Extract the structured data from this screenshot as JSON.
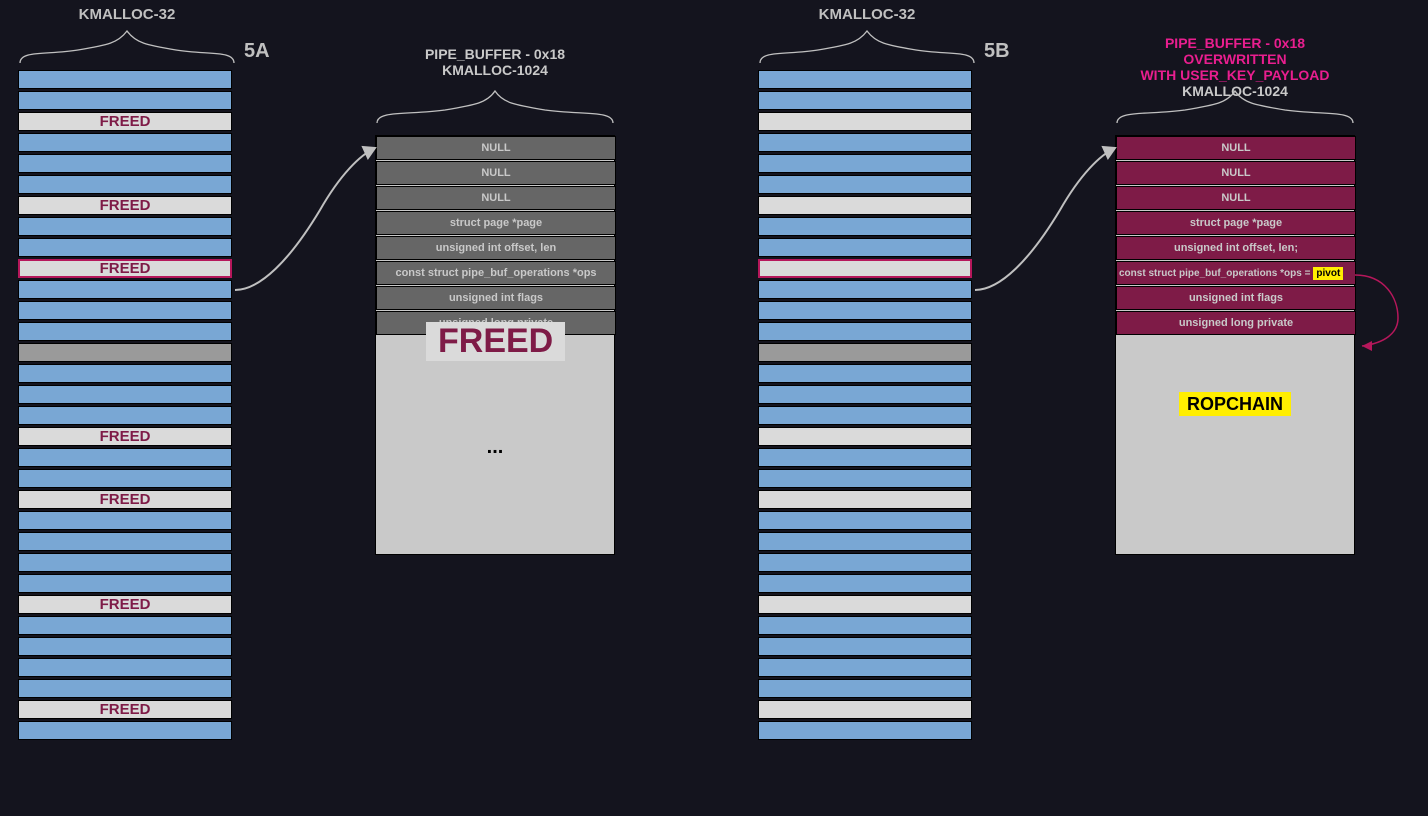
{
  "left_title": "KMALLOC-32",
  "right_title": "KMALLOC-32",
  "step5a": "5A",
  "step5b": "5B",
  "detailA_line1": "PIPE_BUFFER - 0x18",
  "detailA_line2": "KMALLOC-1024",
  "detailB_line1": "PIPE_BUFFER - 0x18 OVERWRITTEN",
  "detailB_line2": "WITH USER_KEY_PAYLOAD",
  "detailB_line3": "KMALLOC-1024",
  "freed_label": "FREED",
  "freed_big": "FREED",
  "ellipsis": "...",
  "ropchain": "ROPCHAIN",
  "pivot": "pivot",
  "rowsA": {
    "r0": "NULL",
    "r1": "NULL",
    "r2": "NULL",
    "r3": "struct page *page",
    "r4": "unsigned int offset, len",
    "r5": "const struct pipe_buf_operations *ops",
    "r6": "unsigned int flags",
    "r7": "unsigned long private"
  },
  "rowsB": {
    "r0": "NULL",
    "r1": "NULL",
    "r2": "NULL",
    "r3": "struct page *page",
    "r4": "unsigned int offset, len;",
    "r5": "const struct pipe_buf_operations *ops =",
    "r6": "unsigned int flags",
    "r7": "unsigned long private"
  },
  "slotsA": [
    "alloc",
    "alloc",
    "freed",
    "alloc",
    "alloc",
    "alloc",
    "freed",
    "alloc",
    "alloc",
    "freed-hl",
    "alloc",
    "alloc",
    "alloc",
    "grey",
    "alloc",
    "alloc",
    "alloc",
    "freed",
    "alloc",
    "alloc",
    "freed",
    "alloc",
    "alloc",
    "alloc",
    "alloc",
    "freed",
    "alloc",
    "alloc",
    "alloc",
    "alloc",
    "freed",
    "alloc"
  ],
  "slotsB": [
    "alloc",
    "alloc",
    "freed-blank",
    "alloc",
    "alloc",
    "alloc",
    "freed-blank",
    "alloc",
    "alloc",
    "blank-hl",
    "alloc",
    "alloc",
    "alloc",
    "grey",
    "alloc",
    "alloc",
    "alloc",
    "freed-blank",
    "alloc",
    "alloc",
    "freed-blank",
    "alloc",
    "alloc",
    "alloc",
    "alloc",
    "freed-blank",
    "alloc",
    "alloc",
    "alloc",
    "alloc",
    "freed-blank",
    "alloc"
  ]
}
